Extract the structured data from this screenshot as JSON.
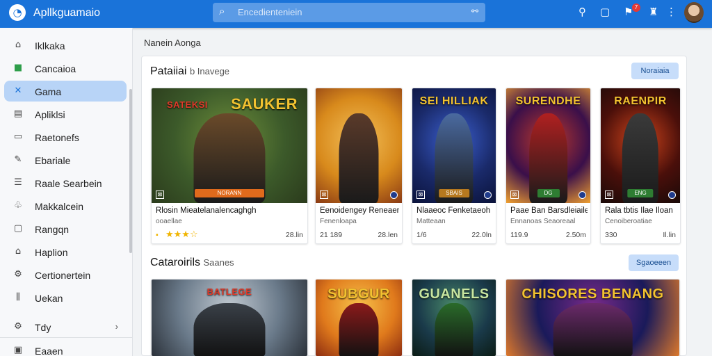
{
  "app": {
    "title": "Apllkguamaio"
  },
  "search": {
    "placeholder": "Encedienteniein"
  },
  "topbar": {
    "badge": "7"
  },
  "sidebar": {
    "items": [
      {
        "label": "Iklkaka",
        "icon": "home-icon"
      },
      {
        "label": "Cancaioa",
        "icon": "store-icon"
      },
      {
        "label": "Gama",
        "icon": "game-icon",
        "active": true
      },
      {
        "label": "Apliklsi",
        "icon": "apps-icon"
      },
      {
        "label": "Raetonefs",
        "icon": "folder-icon"
      },
      {
        "label": "Ebariale",
        "icon": "edit-icon"
      },
      {
        "label": "Raale Searbein",
        "icon": "list-icon"
      },
      {
        "label": "Makkalcein",
        "icon": "people-icon"
      },
      {
        "label": "Rangqn",
        "icon": "tag-icon"
      },
      {
        "label": "Haplion",
        "icon": "house-icon"
      },
      {
        "label": "Certionertein",
        "icon": "gear-icon"
      },
      {
        "label": "Uekan",
        "icon": "library-icon"
      }
    ],
    "bottom": [
      {
        "label": "Tdy",
        "icon": "settings-icon"
      },
      {
        "label": "Eaaen",
        "icon": "account-icon"
      }
    ]
  },
  "breadcrumb": "Nanein Aonga",
  "section1": {
    "title": "Pataiiai",
    "subtitle": "b Inavege",
    "button": "Noraiaia"
  },
  "section2": {
    "title": "Cataroirils",
    "subtitle": "Saanes",
    "button": "Sgaoeeen"
  },
  "cards": [
    {
      "banner": "SAUKER",
      "banner2": "SATEKSI",
      "name": "Rlosin Mieatelanalencaghgh",
      "dev": "ooaellae",
      "meta": "",
      "right": "28.lin",
      "ribbon": "NORANN",
      "rating": 3.5,
      "colors": [
        "#3c5a2a",
        "#6f8f3a",
        "#2b3b1c"
      ],
      "fig": "#6a4a2a",
      "ribbonColor": "#e06a1c"
    },
    {
      "banner": "",
      "banner2": "",
      "name": "Eenoidengey Reneaen",
      "dev": "Fenenloapa",
      "meta": "21 189",
      "right": "28.len",
      "ribbon": "",
      "rating": 0,
      "colors": [
        "#d88a1c",
        "#f3c05a",
        "#8a3a14"
      ],
      "fig": "#5a3a2a",
      "ribbonColor": "#c0392b"
    },
    {
      "banner": "SEI HILLIAK",
      "banner2": "",
      "name": "Nlaaeoc Fenketaeoh",
      "dev": "Matteaan",
      "meta": "1/6",
      "right": "22.0ln",
      "ribbon": "SBAIS",
      "rating": 0,
      "colors": [
        "#1a2a6a",
        "#3b5fd0",
        "#0a123a"
      ],
      "fig": "#4a6aa0",
      "ribbonColor": "#b7791f"
    },
    {
      "banner": "SURENDHE",
      "banner2": "",
      "name": "Paae Ban Barsdleiailer",
      "dev": "Ennanoas Seaoreaal",
      "meta": "119.9",
      "right": "2.50m",
      "ribbon": "DG",
      "rating": 0,
      "colors": [
        "#3a0f4a",
        "#c0392b",
        "#f0a030"
      ],
      "fig": "#b02020",
      "ribbonColor": "#2e7d32"
    },
    {
      "banner": "RAENPIR",
      "banner2": "",
      "name": "Rala tbtis Ilae Iloan",
      "dev": "Cenoiberoatiae",
      "meta": "330",
      "right": "Il.lin",
      "ribbon": "ENG",
      "rating": 0,
      "colors": [
        "#4a0f0a",
        "#d0451c",
        "#1a0a08"
      ],
      "fig": "#3a3a3a",
      "ribbonColor": "#2e7d32"
    }
  ],
  "cards2": [
    {
      "banner": "BATLEGE",
      "colors": [
        "#6a7a8a",
        "#c0c8d0",
        "#2a3038"
      ],
      "fig": "#3a4048"
    },
    {
      "banner": "SUBGUR",
      "colors": [
        "#e07a1c",
        "#f7c24a",
        "#8a2a10"
      ],
      "fig": "#8a1a1a"
    },
    {
      "banner": "GUANELS",
      "colors": [
        "#1a3a4a",
        "#4a8a6a",
        "#0a1a12"
      ],
      "fig": "#2a6a2a"
    },
    {
      "banner": "CHISORES  BENANG",
      "colors": [
        "#1a1a5a",
        "#7a2a8a",
        "#e07a2a"
      ],
      "fig": "#6a2a6a"
    }
  ]
}
